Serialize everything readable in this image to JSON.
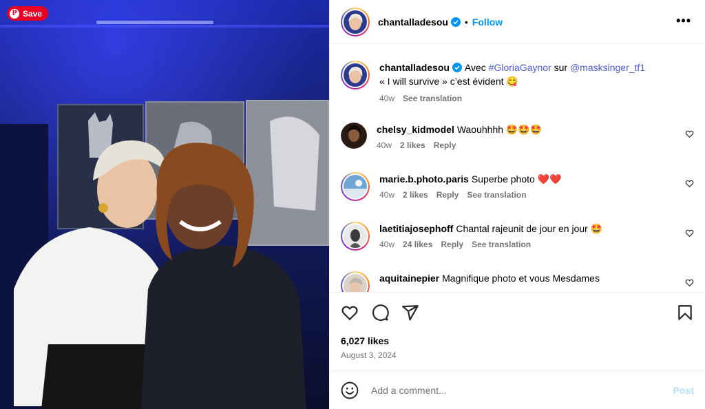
{
  "pin": {
    "save_label": "Save"
  },
  "header": {
    "username": "chantalladesou",
    "separator": "•",
    "follow_label": "Follow",
    "more_label": "•••"
  },
  "caption": {
    "username": "chantalladesou",
    "prefix": "Avec ",
    "hashtag": "#GloriaGaynor",
    "middle": " sur ",
    "mention": "@masksinger_tf1",
    "line2": "« I will survive » c’est évident 😋",
    "time": "40w",
    "translate": "See translation"
  },
  "comments": [
    {
      "username": "chelsy_kidmodel",
      "text": "Waouhhhh 🤩🤩🤩",
      "time": "40w",
      "likes": "2 likes",
      "reply": "Reply",
      "translate": ""
    },
    {
      "username": "marie.b.photo.paris",
      "text": "Superbe photo ❤️❤️",
      "time": "40w",
      "likes": "2 likes",
      "reply": "Reply",
      "translate": "See translation"
    },
    {
      "username": "laetitiajosephoff",
      "text": "Chantal rajeunit de jour en jour 🤩",
      "time": "40w",
      "likes": "24 likes",
      "reply": "Reply",
      "translate": "See translation"
    },
    {
      "username": "aquitainepier",
      "text": "Magnifique photo et vous Mesdames",
      "time": "",
      "likes": "",
      "reply": "",
      "translate": ""
    }
  ],
  "icons": {
    "like": "heart-icon",
    "comment": "comment-icon",
    "share": "share-icon",
    "save": "bookmark-icon",
    "emoji": "emoji-icon"
  },
  "stats": {
    "likes": "6,027 likes",
    "date": "August 3, 2024"
  },
  "composer": {
    "placeholder": "Add a comment...",
    "post_label": "Post"
  },
  "colors": {
    "accent": "#0095f6",
    "link": "#4f5bd5",
    "pin_red": "#e60023"
  }
}
